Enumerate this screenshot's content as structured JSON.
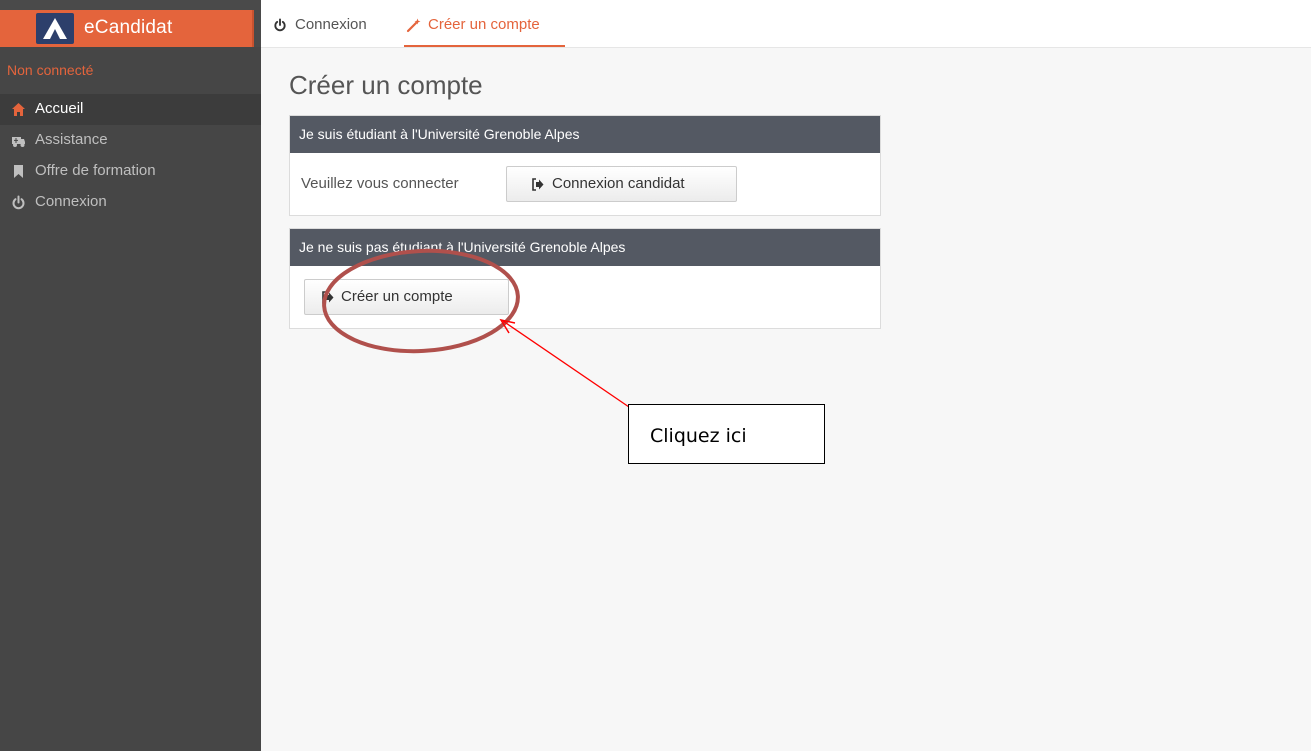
{
  "app": {
    "brand_title": "eCandidat",
    "status_text": "Non connecté",
    "accent_color": "#e4643c"
  },
  "sidebar": {
    "items": [
      {
        "label": "Accueil",
        "icon": "home-icon",
        "active": true
      },
      {
        "label": "Assistance",
        "icon": "support-icon",
        "active": false
      },
      {
        "label": "Offre de formation",
        "icon": "bookmark-icon",
        "active": false
      },
      {
        "label": "Connexion",
        "icon": "power-icon",
        "active": false
      }
    ]
  },
  "tabs": [
    {
      "label": "Connexion",
      "icon": "power-icon",
      "active": false
    },
    {
      "label": "Créer un compte",
      "icon": "magic-wand-icon",
      "active": true
    }
  ],
  "main": {
    "page_title": "Créer un compte",
    "panel_student": {
      "header": "Je suis étudiant à l'Université Grenoble Alpes",
      "text": "Veuillez vous connecter",
      "button_label": "Connexion candidat",
      "button_icon": "sign-in-icon"
    },
    "panel_non_student": {
      "header": "Je ne suis pas étudiant à l'Université Grenoble Alpes",
      "button_label": "Créer un compte",
      "button_icon": "sign-in-icon"
    }
  },
  "annotation": {
    "callout_text": "Cliquez ici",
    "circle_color": "#b0504c",
    "arrow_color": "#ff0000"
  }
}
